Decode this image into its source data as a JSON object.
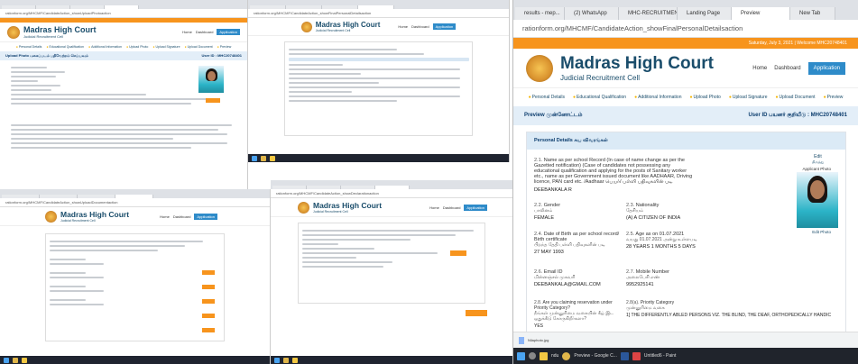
{
  "main_window": {
    "tabs": [
      {
        "label": "results - mep..."
      },
      {
        "label": "(2) WhatsApp"
      },
      {
        "label": "MHC-RECRUITMENT"
      },
      {
        "label": "Landing Page"
      },
      {
        "label": "Preview"
      },
      {
        "label": "New Tab"
      }
    ],
    "address": "rationform.org/MHCMF/CandidateAction_showFinalPersonalDetailsaction",
    "top_notice": "Saturday, July 3, 2021 | Welcome MHC20748401",
    "brand_title": "Madras High Court",
    "brand_subtitle": "Judicial Recruitment Cell",
    "nav": {
      "home": "Home",
      "dashboard": "Dashboard",
      "application": "Application"
    },
    "steps": [
      "Personal Details",
      "Educational Qualification",
      "Additional Information",
      "Upload Photo",
      "Upload Signature",
      "Upload Document",
      "Preview"
    ],
    "preview_label": "Preview முன்னோட்டம்",
    "user_id": "User ID பயனர் குறியீடு : MHC20748401",
    "section_title": "Personal Details சுய விவரங்கள்",
    "edit": "Edit",
    "edit_ta": "திருத்து",
    "applicant_photo_label": "Applicant Photo",
    "edit_photo": "Edit Photo",
    "field_1": {
      "num": "2.1.",
      "label": "Name as per school Record (In case of name change as per the Gazetted notification) (Case of candidates not possessing any educational qualification and applying for the posts of Sanitary worker etc., name as per Government issued document like AADHAAR, Driving licence, PAN card etc. /Aadhaar பெயர்/ பள்ளி பதிவுகளின் படி",
      "value": "DEEBANKALA R"
    },
    "field_2": {
      "num": "2.2.",
      "label": "Gender",
      "label_ta": "பாலினம்",
      "value": "FEMALE"
    },
    "field_3": {
      "num": "2.3.",
      "label": "Nationality",
      "label_ta": "தேசியம்",
      "value": "(A) A CITIZEN OF INDIA"
    },
    "field_4": {
      "num": "2.4.",
      "label": "Date of Birth as per school record/ Birth certificate",
      "label_ta": "பிறந்த தேதி பள்ளி பதிவுகளின் படி",
      "value": "27 MAY 1993"
    },
    "field_5": {
      "num": "2.5.",
      "label": "Age as on 01.07.2021",
      "label_ta": "வயது 01.07.2021 அன்று உள்ளபடி",
      "value": "28 YEARS 1 MONTHS 5 DAYS"
    },
    "field_6": {
      "num": "2.6.",
      "label": "Email ID",
      "label_ta": "மின்னஞ்சல் முகவரி",
      "value": "DEEBANKALA@GMAIL.COM"
    },
    "field_7": {
      "num": "2.7.",
      "label": "Mobile Number",
      "label_ta": "அலைபேசி எண்",
      "value": "9952925141"
    },
    "field_8": {
      "num": "2.8.",
      "label": "Are you claiming reservation under Priority Category?",
      "label_ta": "நீங்கள் முன்னுரிமை வகையின் கீழ் இட ஒதுக்கீடு கோருகிறீர்களா?",
      "value": "YES"
    },
    "field_9": {
      "num": "2.8(a).",
      "label": "Priority Category",
      "label_ta": "முன்னுரிமை வகை",
      "value": "1] THE DIFFERENTLY ABLED PERSONS VIZ. THE BLIND, THE DEAF, ORTHOPEDICALLY HANDIC"
    },
    "download_file": "Nilaphoto.jpg",
    "taskbar_items": [
      "ndu",
      "Preview - Google C...",
      "Untitled6 - Paint"
    ]
  },
  "panel_tl": {
    "brand_title": "Madras High Court",
    "brand_subtitle": "Judicial Recruitment Cell",
    "nav": {
      "home": "Home",
      "dashboard": "Dashboard",
      "application": "Application"
    },
    "steps": [
      "Personal Details",
      "Educational Qualification",
      "Additional Information",
      "Upload Photo",
      "Upload Signature",
      "Upload Document",
      "Preview"
    ],
    "preview_label": "Upload Photo புகைப்படம் பதிவேற்றம் செய்யவும்",
    "user_id": "User ID : MHC20748401",
    "address": "rationform.org/MHCMF/CandidateAction_showUploadPhotoaction",
    "bottom_label": "Nilaphoto.jpg"
  },
  "panel_tc": {
    "brand_title": "Madras High Court",
    "brand_subtitle": "Judicial Recruitment Cell",
    "nav": {
      "home": "Home",
      "dashboard": "Dashboard",
      "application": "Application"
    },
    "address": "rationform.org/MHCMF/CandidateAction_showFinalPersonalDetailsaction"
  },
  "panel_bl": {
    "brand_title": "Madras High Court",
    "brand_subtitle": "Judicial Recruitment Cell",
    "nav": {
      "home": "Home",
      "dashboard": "Dashboard",
      "application": "Application"
    },
    "address": "rationform.org/MHCMF/CandidateAction_showUploadDocumentaction"
  },
  "panel_bc": {
    "brand_title": "Madras High Court",
    "brand_subtitle": "Judicial Recruitment Cell",
    "nav": {
      "home": "Home",
      "dashboard": "Dashboard",
      "application": "Application"
    },
    "address": "rationform.org/MHCMF/CandidateAction_showDeclarationaction"
  },
  "colors": {
    "accent_orange": "#f7941d",
    "brand_blue": "#1a4d6b",
    "header_blue": "#e3eef8",
    "link_blue": "#2e8bc9"
  }
}
